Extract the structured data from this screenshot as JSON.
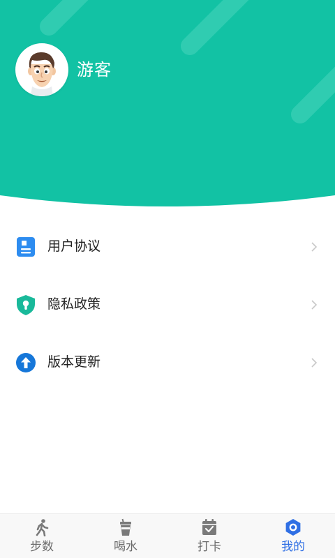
{
  "colors": {
    "header_bg": "#12c2a4",
    "header_stripe": "#3ad0b6",
    "tab_active": "#2f6fe4",
    "tab_inactive": "#6b6b6b",
    "icon_doc": "#2d8cf0",
    "icon_shield": "#19b99a",
    "icon_update": "#1677d9"
  },
  "header": {
    "avatar_icon": "cartoon-man-avatar",
    "username": "游客"
  },
  "menu": {
    "items": [
      {
        "id": "user-agreement",
        "label": "用户协议",
        "icon": "document-icon"
      },
      {
        "id": "privacy-policy",
        "label": "隐私政策",
        "icon": "shield-lock-icon"
      },
      {
        "id": "version-update",
        "label": "版本更新",
        "icon": "arrow-up-circle-icon"
      }
    ]
  },
  "tabbar": {
    "tabs": [
      {
        "id": "steps",
        "label": "步数",
        "icon": "walking-icon",
        "active": false
      },
      {
        "id": "water",
        "label": "喝水",
        "icon": "cup-icon",
        "active": false
      },
      {
        "id": "checkin",
        "label": "打卡",
        "icon": "calendar-check-icon",
        "active": false
      },
      {
        "id": "mine",
        "label": "我的",
        "icon": "hexagon-user-icon",
        "active": true
      }
    ]
  }
}
